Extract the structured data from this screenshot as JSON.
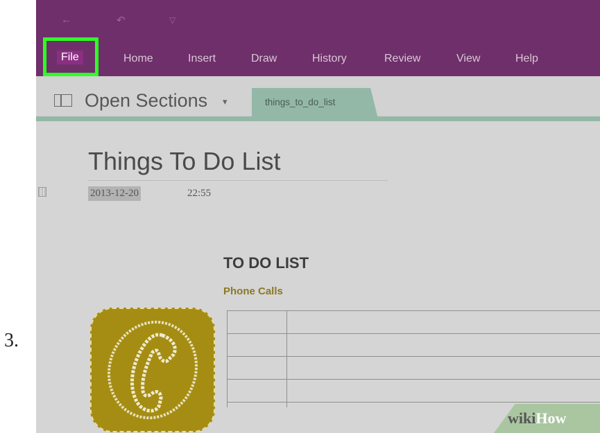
{
  "step": {
    "number": "3."
  },
  "quick_access": {
    "back_icon": "back-arrow-icon",
    "undo_icon": "undo-icon",
    "customize_icon": "dropdown-caret-icon"
  },
  "ribbon": {
    "tabs": [
      {
        "label": "File",
        "highlighted": true
      },
      {
        "label": "Home"
      },
      {
        "label": "Insert"
      },
      {
        "label": "Draw"
      },
      {
        "label": "History"
      },
      {
        "label": "Review"
      },
      {
        "label": "View"
      },
      {
        "label": "Help"
      }
    ],
    "highlight_color": "#2dff22",
    "bar_color": "#6f2f6b"
  },
  "section_bar": {
    "open_sections_label": "Open Sections",
    "dropdown_glyph": "▾",
    "section_tab_label": "things_to_do_list",
    "section_color": "#94b8a7"
  },
  "page": {
    "title": "Things To Do List",
    "date": "2013-12-20",
    "time": "22:55",
    "heading": "TO DO LIST",
    "subheading": "Phone Calls"
  },
  "table": {
    "rows": 5,
    "columns": 2
  },
  "watermark": {
    "wiki": "wiki",
    "how": "How"
  }
}
